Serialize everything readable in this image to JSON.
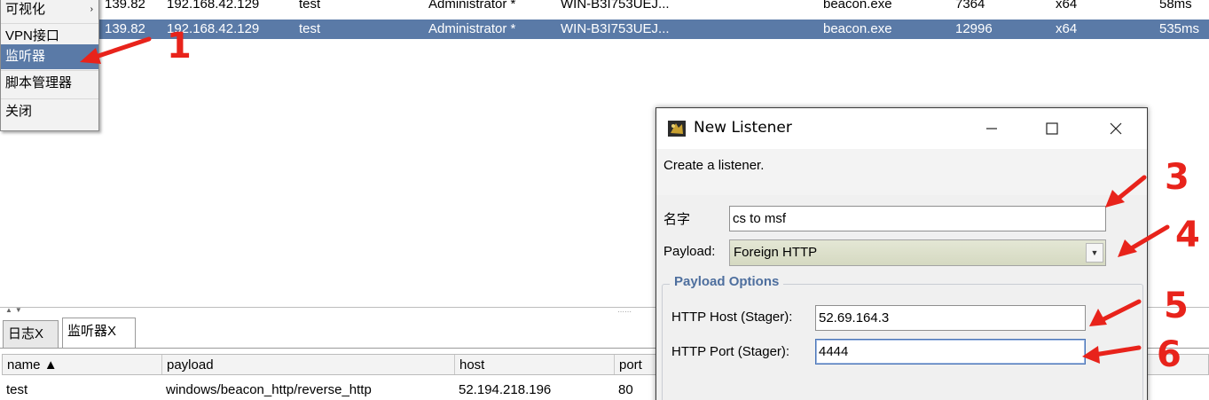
{
  "beacons": {
    "rows": [
      {
        "external_ip": "139.82",
        "internal_ip": "192.168.42.129",
        "user": "test",
        "computer_user": "Administrator *",
        "computer": "WIN-B3I753UEJ...",
        "process": "beacon.exe",
        "pid": "7364",
        "arch": "x64",
        "last": "58ms"
      },
      {
        "external_ip": "139.82",
        "internal_ip": "192.168.42.129",
        "user": "test",
        "computer_user": "Administrator *",
        "computer": "WIN-B3I753UEJ...",
        "process": "beacon.exe",
        "pid": "12996",
        "arch": "x64",
        "last": "535ms"
      }
    ]
  },
  "context_menu": {
    "items": [
      {
        "label": "可视化",
        "submenu": "›"
      },
      {
        "label": "VPN接口"
      },
      {
        "label": "监听器"
      },
      {
        "label": "脚本管理器"
      },
      {
        "label": "关闭"
      }
    ]
  },
  "tabs": [
    {
      "label": "日志X"
    },
    {
      "label": "监听器X"
    }
  ],
  "listeners": {
    "columns": [
      "name ▲",
      "payload",
      "host",
      "port"
    ],
    "rows": [
      {
        "name": "test",
        "payload": "windows/beacon_http/reverse_http",
        "host": "52.194.218.196",
        "port": "80"
      }
    ]
  },
  "dialog": {
    "title": "New Listener",
    "description": "Create a listener.",
    "name_label": "名字",
    "name_value": "cs to msf",
    "payload_label": "Payload:",
    "payload_value": "Foreign HTTP",
    "group_title": "Payload Options",
    "host_label": "HTTP Host (Stager):",
    "host_value": "52.69.164.3",
    "port_label": "HTTP Port (Stager):",
    "port_value": "4444"
  },
  "annotations": [
    "1",
    "3",
    "4",
    "5",
    "6"
  ],
  "colors": {
    "selection": "#5a7aa7",
    "annotation_red": "#e8231b",
    "group_title": "#4e6f9e"
  }
}
